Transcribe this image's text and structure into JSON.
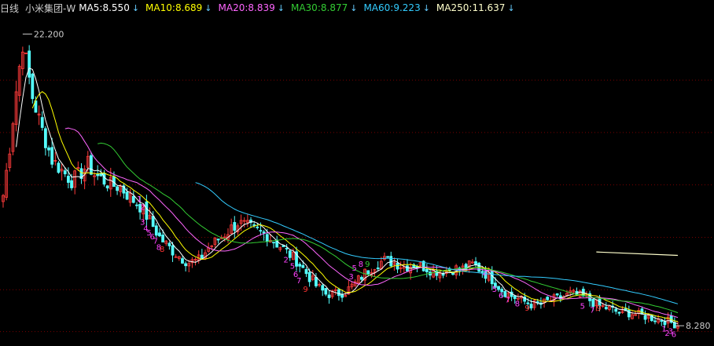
{
  "chart_data": {
    "type": "candlestick",
    "period_label": "日线",
    "stock_name": "小米集团-W",
    "ylim": [
      7.5,
      23.0
    ],
    "ma_legend": [
      {
        "name": "MA5",
        "value": "8.550",
        "color": "#ffffff",
        "arrow": "↓"
      },
      {
        "name": "MA10",
        "value": "8.689",
        "color": "#ffff00",
        "arrow": "↓"
      },
      {
        "name": "MA20",
        "value": "8.839",
        "color": "#ff66ff",
        "arrow": "↓"
      },
      {
        "name": "MA30",
        "value": "8.877",
        "color": "#33cc33",
        "arrow": "↓"
      },
      {
        "name": "MA60",
        "value": "9.223",
        "color": "#33ccff",
        "arrow": "↓"
      },
      {
        "name": "MA250",
        "value": "11.637",
        "color": "#ffffcc",
        "arrow": "↓"
      }
    ],
    "high_annotation": "22.200",
    "low_annotation": "8.280",
    "price_path": [
      [
        0,
        14.5
      ],
      [
        2,
        16.8
      ],
      [
        4,
        19.5
      ],
      [
        6,
        21.8
      ],
      [
        7,
        20.9
      ],
      [
        9,
        19.2
      ],
      [
        12,
        17.6
      ],
      [
        15,
        16.2
      ],
      [
        18,
        15.7
      ],
      [
        21,
        15.2
      ],
      [
        24,
        15.6
      ],
      [
        26,
        16.0
      ],
      [
        28,
        15.5
      ],
      [
        30,
        15.3
      ],
      [
        33,
        15.0
      ],
      [
        36,
        14.9
      ],
      [
        39,
        14.4
      ],
      [
        42,
        14.0
      ],
      [
        45,
        13.3
      ],
      [
        48,
        12.5
      ],
      [
        51,
        12.0
      ],
      [
        54,
        11.6
      ],
      [
        57,
        11.3
      ],
      [
        60,
        11.4
      ],
      [
        63,
        12.0
      ],
      [
        66,
        12.4
      ],
      [
        69,
        12.8
      ],
      [
        72,
        13.2
      ],
      [
        75,
        13.0
      ],
      [
        78,
        12.8
      ],
      [
        81,
        12.6
      ],
      [
        84,
        12.2
      ],
      [
        87,
        11.8
      ],
      [
        90,
        11.4
      ],
      [
        93,
        10.8
      ],
      [
        96,
        10.2
      ],
      [
        99,
        9.8
      ],
      [
        102,
        9.8
      ],
      [
        105,
        9.9
      ],
      [
        108,
        10.3
      ],
      [
        111,
        10.8
      ],
      [
        114,
        11.2
      ],
      [
        117,
        11.4
      ],
      [
        120,
        11.3
      ],
      [
        123,
        11.1
      ],
      [
        126,
        11.2
      ],
      [
        129,
        11.1
      ],
      [
        132,
        10.9
      ],
      [
        135,
        10.9
      ],
      [
        138,
        11.0
      ],
      [
        141,
        11.0
      ],
      [
        144,
        11.2
      ],
      [
        147,
        10.9
      ],
      [
        150,
        10.5
      ],
      [
        153,
        10.0
      ],
      [
        156,
        9.7
      ],
      [
        159,
        9.5
      ],
      [
        162,
        9.3
      ],
      [
        165,
        9.3
      ],
      [
        168,
        9.5
      ],
      [
        171,
        9.6
      ],
      [
        174,
        9.8
      ],
      [
        177,
        9.7
      ],
      [
        180,
        9.5
      ],
      [
        183,
        9.2
      ],
      [
        186,
        9.1
      ],
      [
        189,
        8.9
      ],
      [
        192,
        8.9
      ],
      [
        195,
        8.8
      ],
      [
        198,
        8.7
      ],
      [
        201,
        8.6
      ],
      [
        204,
        8.5
      ],
      [
        207,
        8.3
      ]
    ],
    "ma250_segment": [
      [
        182,
        11.8
      ],
      [
        207,
        11.637
      ]
    ],
    "td_sequence_marks": [
      {
        "t": 41,
        "p": 14.2,
        "text": "1",
        "color": "#ff44ff"
      },
      {
        "t": 42,
        "p": 13.8,
        "text": "2",
        "color": "#ff44ff"
      },
      {
        "t": 42,
        "p": 13.1,
        "text": "3",
        "color": "#ff44ff"
      },
      {
        "t": 43,
        "p": 12.8,
        "text": "4",
        "color": "#ff44ff"
      },
      {
        "t": 44,
        "p": 12.6,
        "text": "5",
        "color": "#ff44ff"
      },
      {
        "t": 45,
        "p": 12.4,
        "text": "6",
        "color": "#ff44ff"
      },
      {
        "t": 46,
        "p": 12.2,
        "text": "7",
        "color": "#ff44ff"
      },
      {
        "t": 47,
        "p": 11.9,
        "text": "8",
        "color": "#ff44ff"
      },
      {
        "t": 48,
        "p": 11.8,
        "text": "8",
        "color": "#ff3333"
      },
      {
        "t": 86,
        "p": 11.3,
        "text": "2",
        "color": "#ff44ff"
      },
      {
        "t": 88,
        "p": 11.0,
        "text": "5",
        "color": "#ff44ff"
      },
      {
        "t": 89,
        "p": 10.6,
        "text": "6",
        "color": "#ff44ff"
      },
      {
        "t": 90,
        "p": 10.3,
        "text": "7",
        "color": "#ff44ff"
      },
      {
        "t": 92,
        "p": 9.9,
        "text": "9",
        "color": "#ff3333"
      },
      {
        "t": 106,
        "p": 10.5,
        "text": "3",
        "color": "#ff44ff"
      },
      {
        "t": 107,
        "p": 10.9,
        "text": "5",
        "color": "#ff44ff"
      },
      {
        "t": 109,
        "p": 11.1,
        "text": "8",
        "color": "#ff44ff"
      },
      {
        "t": 111,
        "p": 11.1,
        "text": "9",
        "color": "#33cc33"
      },
      {
        "t": 147,
        "p": 10.7,
        "text": "2",
        "color": "#ff44ff"
      },
      {
        "t": 150,
        "p": 9.9,
        "text": "5",
        "color": "#ff44ff"
      },
      {
        "t": 152,
        "p": 9.6,
        "text": "6",
        "color": "#ff44ff"
      },
      {
        "t": 154,
        "p": 9.4,
        "text": "7",
        "color": "#ff44ff"
      },
      {
        "t": 157,
        "p": 9.2,
        "text": "8",
        "color": "#ff44ff"
      },
      {
        "t": 160,
        "p": 9.0,
        "text": "9",
        "color": "#ff3333"
      },
      {
        "t": 177,
        "p": 9.1,
        "text": "5",
        "color": "#ff44ff"
      },
      {
        "t": 180,
        "p": 8.9,
        "text": "7",
        "color": "#ff44ff"
      },
      {
        "t": 182,
        "p": 9.0,
        "text": "9",
        "color": "#ff3333"
      },
      {
        "t": 202,
        "p": 8.0,
        "text": "1",
        "color": "#ff44ff"
      },
      {
        "t": 203,
        "p": 7.8,
        "text": "2",
        "color": "#ff44ff"
      },
      {
        "t": 204,
        "p": 7.9,
        "text": "3",
        "color": "#ff44ff"
      },
      {
        "t": 205,
        "p": 7.75,
        "text": "6",
        "color": "#ff44ff"
      }
    ]
  }
}
